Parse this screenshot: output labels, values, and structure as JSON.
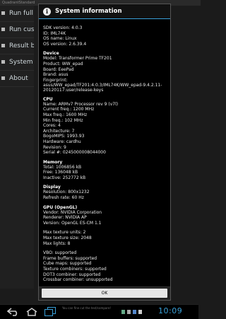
{
  "app": {
    "title": "QuadrantStandard"
  },
  "menu": {
    "items": [
      {
        "label": "Run full",
        "icon": "run-icon"
      },
      {
        "label": "Run cus",
        "icon": "run-icon"
      },
      {
        "label": "Result b",
        "icon": "results-icon"
      },
      {
        "label": "System",
        "icon": "system-icon"
      },
      {
        "label": "About",
        "icon": "question-icon"
      }
    ]
  },
  "dialog": {
    "title": "System information",
    "icon": "info-icon",
    "sections": [
      {
        "title": "",
        "lines": [
          "SDK version: 4.0.3",
          "ID: IML74K",
          "OS name: Linux",
          "OS version: 2.6.39.4"
        ]
      },
      {
        "title": "Device",
        "lines": [
          "Model: Transformer Prime TF201",
          "Product: WW_epad",
          "Board: EeePad",
          "Brand: asus",
          "Fingerprint: asus/WW_epad/TF201:4.0.3/IML74K/WW_epad-9.4.2.11-20120117:user/release-keys"
        ]
      },
      {
        "title": "CPU",
        "lines": [
          "Name: ARMv7 Processor rev 9 (v7l)",
          "Current freq.: 1200 MHz",
          "Max freq.: 1600 MHz",
          "Min freq.: 102 MHz",
          "Cores: 4",
          "Architecture: 7",
          "BogoMIPS: 1993.93",
          "Hardware: cardhu",
          "Revision: 9",
          "Serial #: 0245000008044000"
        ]
      },
      {
        "title": "Memory",
        "lines": [
          "Total: 1006856 kB",
          "Free: 136048 kB",
          "Inactive: 252772 kB"
        ]
      },
      {
        "title": "Display",
        "lines": [
          "Resolution: 800x1232",
          "Refresh rate: 60 Hz"
        ]
      },
      {
        "title": "GPU (OpenGL)",
        "lines": [
          "Vendor: NVIDIA Corporation",
          "Renderer: NVIDIA AP",
          "Version: OpenGL ES-CM 1.1"
        ]
      },
      {
        "title": "",
        "lines": [
          "Max texture units: 2",
          "Max texture size: 2048",
          "Max lights: 8"
        ]
      },
      {
        "title": "",
        "lines": [
          "VBO: supported",
          "Frame buffers: supported",
          "Cube maps: supported",
          "Texture combiners: supported",
          "DOT3 combiner: supported",
          "Crossbar combiner: unsupported"
        ]
      }
    ],
    "ok_label": "OK"
  },
  "navbar": {
    "status_message": "You can fine cut the test/compare!",
    "clock": "10:09",
    "accent": "#3aa0d8"
  }
}
